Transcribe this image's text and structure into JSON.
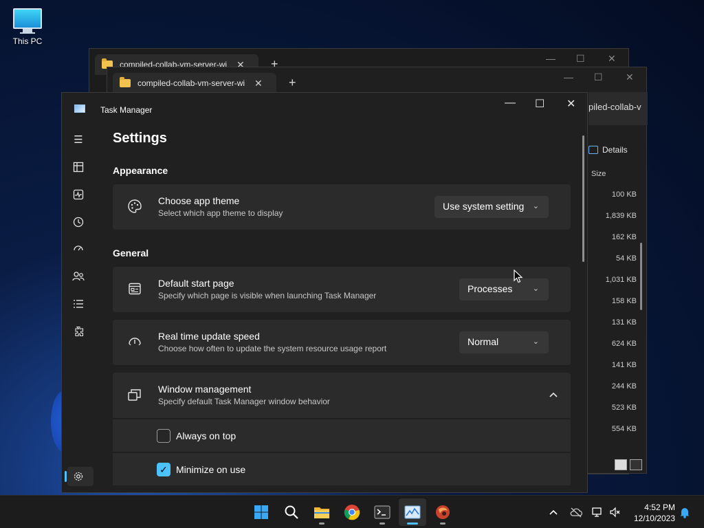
{
  "desktop": {
    "icons": [
      {
        "label": "This PC",
        "icon": "this-pc-icon"
      }
    ]
  },
  "explorer_back": {
    "tab_label": "compiled-collab-vm-server-wi",
    "close_glyph": "✕",
    "new_tab_glyph": "+",
    "controls": {
      "minimize": "—",
      "maximize": "☐",
      "close": "✕"
    }
  },
  "explorer_front": {
    "tab_label": "compiled-collab-vm-server-wi",
    "close_glyph": "✕",
    "new_tab_glyph": "+",
    "controls": {
      "minimize": "—",
      "maximize": "☐",
      "close": "✕"
    },
    "path_fragment": "piled-collab-v",
    "details_label": "Details",
    "size_header": "Size",
    "sizes": [
      "100 KB",
      "1,839 KB",
      "162 KB",
      "54 KB",
      "1,031 KB",
      "158 KB",
      "131 KB",
      "624 KB",
      "141 KB",
      "244 KB",
      "523 KB",
      "554 KB"
    ]
  },
  "task_manager": {
    "title": "Task Manager",
    "controls": {
      "minimize": "—",
      "maximize": "☐",
      "close": "✕"
    },
    "nav_icons": [
      "hamburger-icon",
      "processes-icon",
      "performance-icon",
      "app-history-icon",
      "startup-apps-icon",
      "users-icon",
      "details-icon",
      "services-icon",
      "settings-icon"
    ],
    "page_title": "Settings",
    "appearance": {
      "heading": "Appearance",
      "theme": {
        "title": "Choose app theme",
        "subtitle": "Select which app theme to display",
        "value": "Use system setting"
      }
    },
    "general": {
      "heading": "General",
      "start_page": {
        "title": "Default start page",
        "subtitle": "Specify which page is visible when launching Task Manager",
        "value": "Processes"
      },
      "update_speed": {
        "title": "Real time update speed",
        "subtitle": "Choose how often to update the system resource usage report",
        "value": "Normal"
      },
      "window_management": {
        "title": "Window management",
        "subtitle": "Specify default Task Manager window behavior",
        "options": [
          {
            "label": "Always on top",
            "checked": false
          },
          {
            "label": "Minimize on use",
            "checked": true
          }
        ]
      }
    }
  },
  "taskbar": {
    "apps": [
      "windows-start-icon",
      "search-icon",
      "file-explorer-icon",
      "chrome-icon",
      "terminal-icon",
      "task-manager-icon",
      "app-icon"
    ],
    "clock_time": "4:52 PM",
    "clock_date": "12/10/2023",
    "accent": "#4cc2ff"
  }
}
